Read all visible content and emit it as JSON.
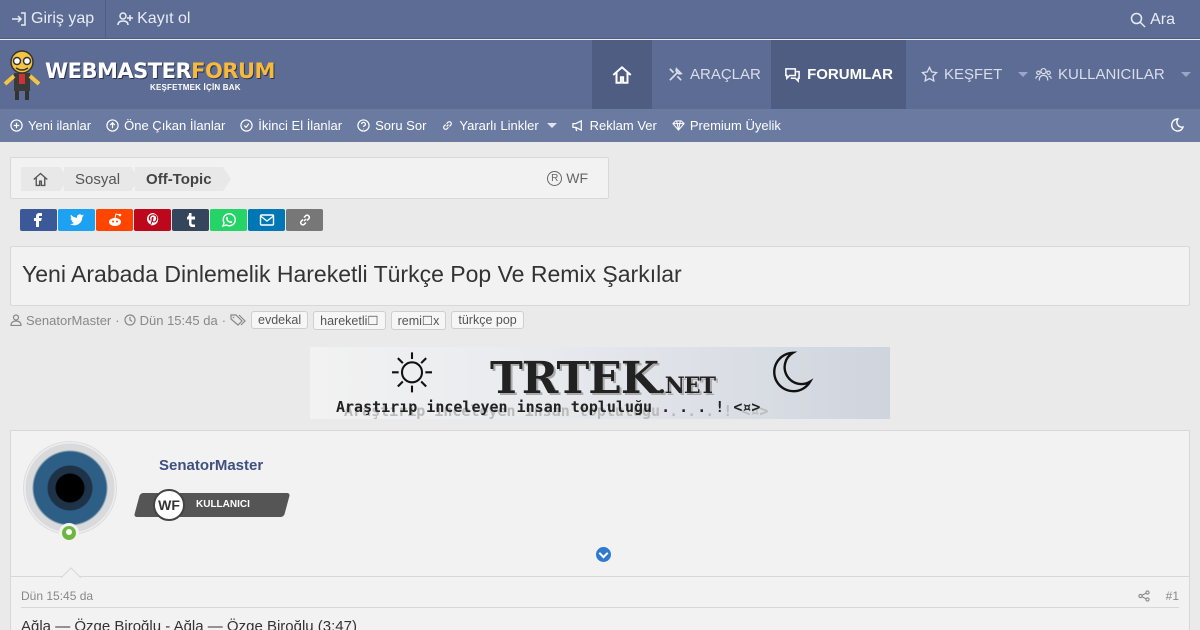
{
  "topbar": {
    "login": "Giriş yap",
    "register": "Kayıt ol",
    "search": "Ara"
  },
  "logo": {
    "brand_a": "WEBMASTER",
    "brand_b": "FORUM",
    "tagline": "KEŞFETMEK İÇİN BAK"
  },
  "nav": {
    "tools": "ARAÇLAR",
    "forums": "FORUMLAR",
    "explore": "KEŞFET",
    "users": "KULLANICILAR"
  },
  "subnav": [
    "Yeni ilanlar",
    "Öne Çıkan İlanlar",
    "İkinci El İlanlar",
    "Soru Sor",
    "Yararlı Linkler",
    "Reklam Ver",
    "Premium Üyelik"
  ],
  "breadcrumb": {
    "items": [
      "Sosyal",
      "Off-Topic"
    ],
    "badge": "WF"
  },
  "thread": {
    "title": "Yeni Arabada Dinlemelik Hareketli Türkçe Pop Ve Remix Şarkılar",
    "author": "SenatorMaster",
    "date": "Dün 15:45 da",
    "tags": [
      "evdekal",
      "hareketli☐",
      "remi☐x",
      "türkçe pop"
    ]
  },
  "banner": {
    "brand": "TRTEK",
    "brand_suffix": ".NET",
    "slogan": "Araştırıp inceleyen insan topluluğu . . . ! <¤>"
  },
  "post": {
    "username": "SenatorMaster",
    "rank": "KULLANICI",
    "rank_logo": "WF",
    "date": "Dün 15:45 da",
    "number": "#1",
    "text": "Ağla — Özge Biroğlu - Ağla — Özge Biroğlu (3:47)"
  },
  "colors": {
    "header_bg": "#5d6c94",
    "subnav_bg": "#6a7aa1",
    "accent": "#f6b93b",
    "facebook": "#3b5998",
    "twitter": "#1da1f2",
    "reddit": "#ff4500",
    "pinterest": "#bd081c",
    "tumblr": "#35465c",
    "whatsapp": "#25d366",
    "email": "#0077b5",
    "link": "#777777"
  }
}
